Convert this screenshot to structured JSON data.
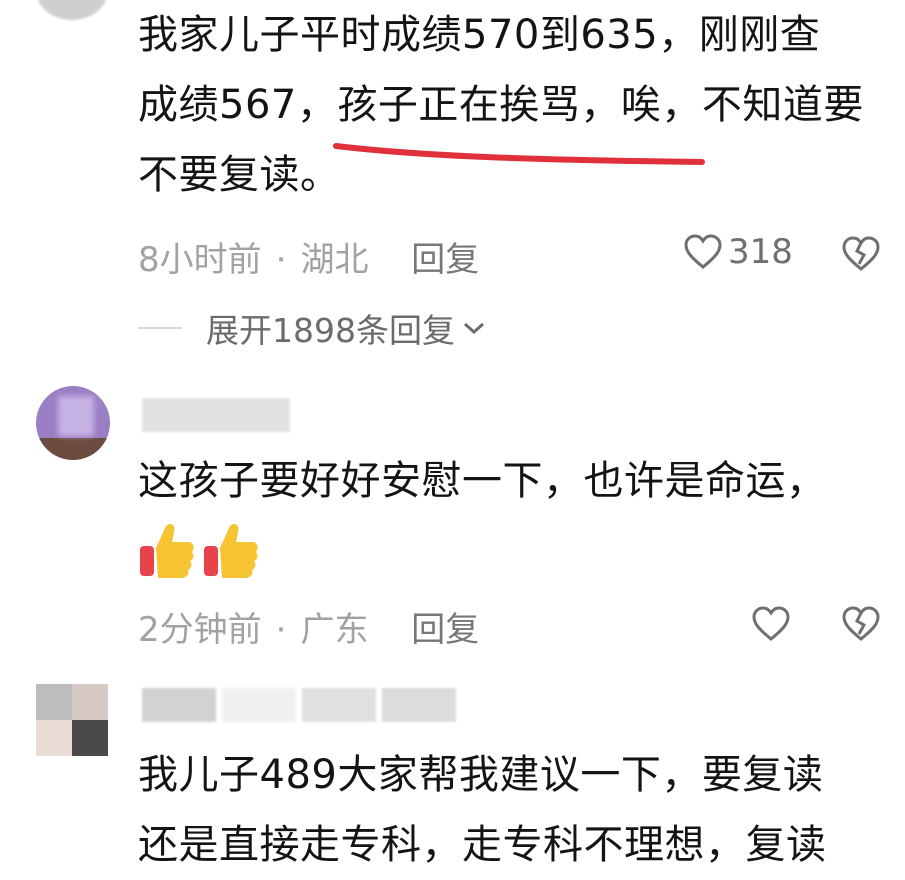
{
  "comments": [
    {
      "text_lines": [
        "我家儿子平时成绩570到635，刚刚查",
        "成绩567，孩子正在挨骂，唉，不知道要",
        "不要复读。"
      ],
      "time": "8小时前",
      "location": "湖北",
      "reply_label": "回复",
      "like_count": "318",
      "expand_label": "展开1898条回复"
    },
    {
      "text_lines": [
        "这孩子要好好安慰一下，也许是命运，"
      ],
      "emoji": [
        "thumbs-up",
        "thumbs-up"
      ],
      "time": "2分钟前",
      "location": "广东",
      "reply_label": "回复"
    },
    {
      "text_lines": [
        "我儿子489大家帮我建议一下，要复读",
        "还是直接走专科，走专科不理想，复读"
      ]
    }
  ],
  "colors": {
    "underline": "#e0303a",
    "meta": "#a2a2a2",
    "avatar_purple": "#9b7fc4"
  },
  "icons": [
    "heart-icon",
    "broken-heart-icon",
    "chevron-down-icon",
    "thumbs-up-emoji"
  ]
}
